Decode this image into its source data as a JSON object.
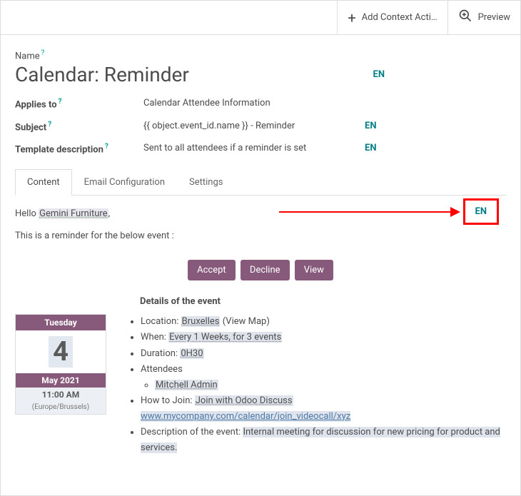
{
  "topbar": {
    "add_context_label": "Add Context Acti…",
    "preview_label": "Preview"
  },
  "name_label": "Name",
  "title": "Calendar: Reminder",
  "title_lang": "EN",
  "fields": {
    "applies_to": {
      "label": "Applies to",
      "value": "Calendar Attendee Information"
    },
    "subject": {
      "label": "Subject",
      "value": "{{ object.event_id.name }} - Reminder",
      "lang": "EN"
    },
    "template_desc": {
      "label": "Template description",
      "value": "Sent to all attendees if a reminder is set",
      "lang": "EN"
    }
  },
  "tabs": {
    "content": "Content",
    "email_config": "Email Configuration",
    "settings": "Settings"
  },
  "body": {
    "hello": "Hello ",
    "recipient": "Gemini Furniture",
    "comma": ",",
    "reminder_line": "This is a reminder for the below event :",
    "accept": "Accept",
    "decline": "Decline",
    "view": "View",
    "details_title": "Details of the event",
    "callout_lang": "EN"
  },
  "calendar": {
    "weekday": "Tuesday",
    "day": "4",
    "month_year": "May 2021",
    "time": "11:00 AM",
    "tz": "(Europe/Brussels)"
  },
  "details": {
    "loc_label": "Location: ",
    "loc_value": "Bruxelles",
    "loc_suffix": " (View Map)",
    "when_label": "When: ",
    "when_value": "Every 1 Weeks, for 3 events",
    "dur_label": "Duration: ",
    "dur_value": "0H30",
    "attendees_label": "Attendees",
    "attendee1": "Mitchell Admin",
    "how_label": "How to Join: ",
    "how_value": "Join with Odoo Discuss",
    "how_url": "www.mycompany.com/calendar/join_videocall/xyz",
    "desc_label": "Description of the event: ",
    "desc_value": "Internal meeting for discussion for new pricing for product and services."
  }
}
